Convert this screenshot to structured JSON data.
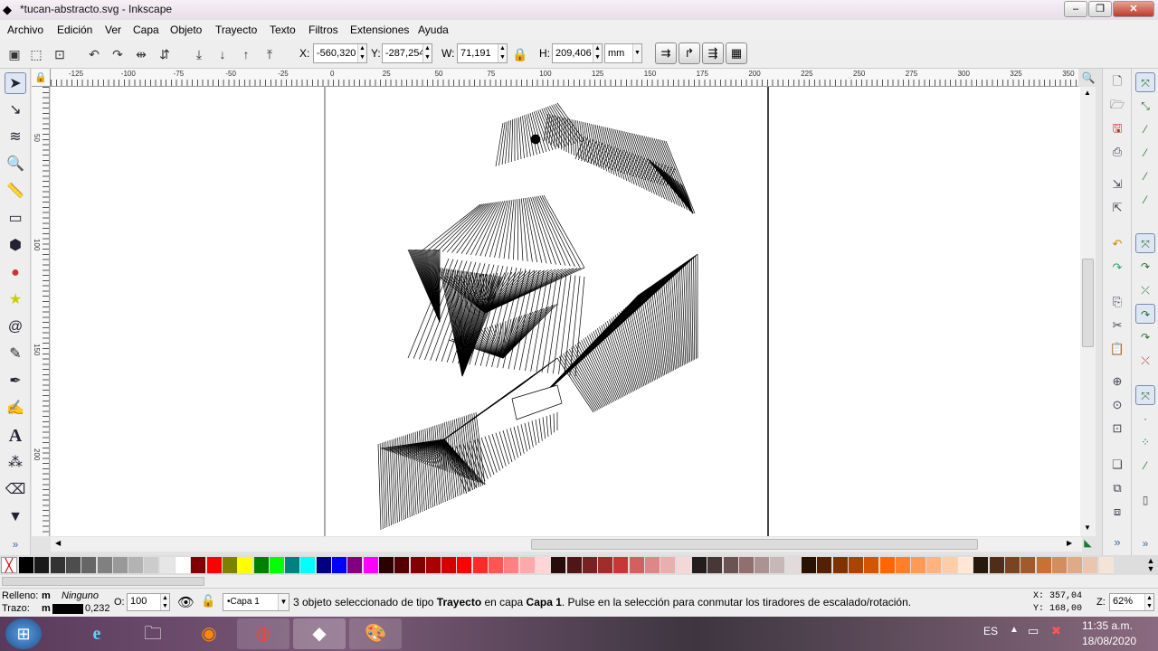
{
  "window": {
    "title": "*tucan-abstracto.svg - Inkscape"
  },
  "menu": [
    "Archivo",
    "Edición",
    "Ver",
    "Capa",
    "Objeto",
    "Trayecto",
    "Texto",
    "Filtros",
    "Extensiones",
    "Ayuda"
  ],
  "toolbar": {
    "x_label": "X:",
    "x_value": "-560,320",
    "y_label": "Y:",
    "y_value": "-287,254",
    "w_label": "W:",
    "w_value": "71,191",
    "h_label": "H:",
    "h_value": "209,406",
    "unit": "mm"
  },
  "ruler": {
    "h_ticks": [
      "-125",
      "-100",
      "-75",
      "-50",
      "-25",
      "0",
      "25",
      "50",
      "75",
      "100",
      "125",
      "150",
      "175",
      "200",
      "225",
      "250",
      "275",
      "300",
      "325",
      "350"
    ],
    "v_ticks": [
      "50",
      "100",
      "150",
      "200"
    ]
  },
  "status": {
    "fill_label": "Relleno:",
    "fill_code": "m",
    "fill_value": "Ninguno",
    "stroke_label": "Trazo:",
    "stroke_code": "m",
    "stroke_width": "0,232",
    "opacity_label": "O:",
    "opacity_value": "100",
    "layer": "Capa 1",
    "message_pre": "3 objeto seleccionado de tipo ",
    "message_type": "Trayecto",
    "message_mid": " en capa ",
    "message_layer": "Capa 1",
    "message_post": ". Pulse en la selección para conmutar los tiradores de escalado/rotación.",
    "cursor_x_label": "X:",
    "cursor_x": "357,04",
    "cursor_y_label": "Y:",
    "cursor_y": "168,00",
    "zoom_label": "Z:",
    "zoom_value": "62%"
  },
  "taskbar": {
    "lang": "ES",
    "time": "11:35 a.m.",
    "date": "18/08/2020"
  },
  "palette_colors": [
    "#000000",
    "#1a1a1a",
    "#333333",
    "#4d4d4d",
    "#666666",
    "#808080",
    "#999999",
    "#b3b3b3",
    "#cccccc",
    "#e6e6e6",
    "#ffffff",
    "#800000",
    "#ff0000",
    "#808000",
    "#ffff00",
    "#008000",
    "#00ff00",
    "#008080",
    "#00ffff",
    "#000080",
    "#0000ff",
    "#800080",
    "#ff00ff",
    "#2b0000",
    "#550000",
    "#800000",
    "#aa0000",
    "#d40000",
    "#ff0000",
    "#ff2a2a",
    "#ff5555",
    "#ff8080",
    "#ffaaaa",
    "#ffd5d5",
    "#280b0b",
    "#501616",
    "#782121",
    "#a02c2c",
    "#c83737",
    "#d35f5f",
    "#de8787",
    "#e9afaf",
    "#f4d7d7",
    "#241c1c",
    "#483737",
    "#6c5353",
    "#916f6f",
    "#ac9393",
    "#c8b7b7",
    "#e3dbdb",
    "#2b1100",
    "#552200",
    "#803300",
    "#aa4400",
    "#d45500",
    "#ff6600",
    "#ff7f2a",
    "#ff9955",
    "#ffb380",
    "#ffccaa",
    "#ffe6d5",
    "#28170b",
    "#502d16",
    "#784421",
    "#a05a2c",
    "#c87137",
    "#d38d5f",
    "#deaa87",
    "#e9c6af",
    "#f4e3d7"
  ]
}
